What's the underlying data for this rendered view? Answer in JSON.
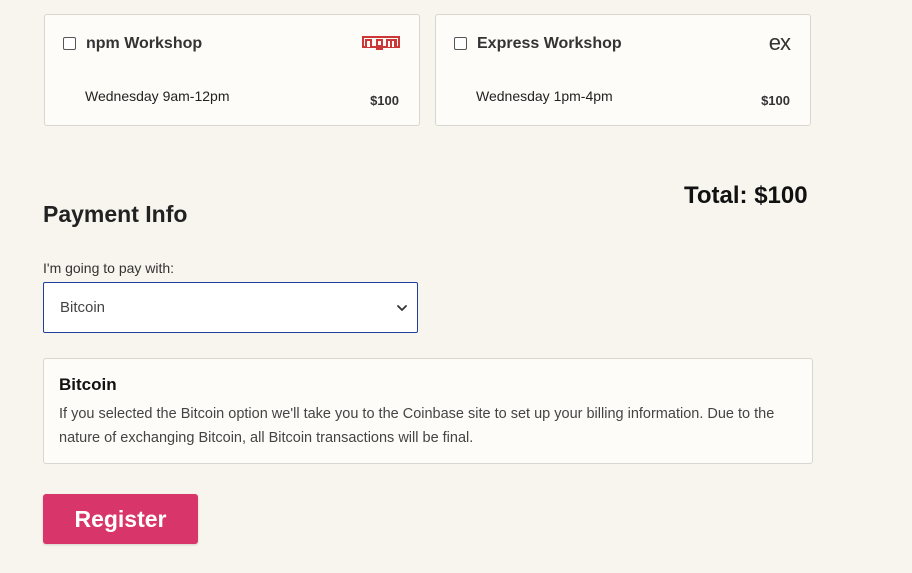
{
  "workshops": [
    {
      "title": "npm Workshop",
      "time": "Wednesday 9am-12pm",
      "price": "$100",
      "checked": false,
      "logo": "npm",
      "logo_icon": "npm-logo-icon",
      "logo_color": "#cb3837"
    },
    {
      "title": "Express Workshop",
      "time": "Wednesday 1pm-4pm",
      "price": "$100",
      "checked": false,
      "logo": "ex",
      "logo_icon": "express-logo-icon"
    }
  ],
  "total": "Total: $100",
  "payment": {
    "heading": "Payment Info",
    "label": "I'm going to pay with:",
    "selected": "Bitcoin",
    "chevron_icon": "chevron-down-icon"
  },
  "info_box": {
    "title": "Bitcoin",
    "text": "If you selected the Bitcoin option we'll take you to the Coinbase site to set up your billing information. Due to the nature of exchanging Bitcoin, all Bitcoin transactions will be final."
  },
  "register": {
    "label": "Register",
    "color": "#d8356a"
  },
  "colors": {
    "background": "#f8f4ee",
    "select_border": "#1f3f9c"
  }
}
